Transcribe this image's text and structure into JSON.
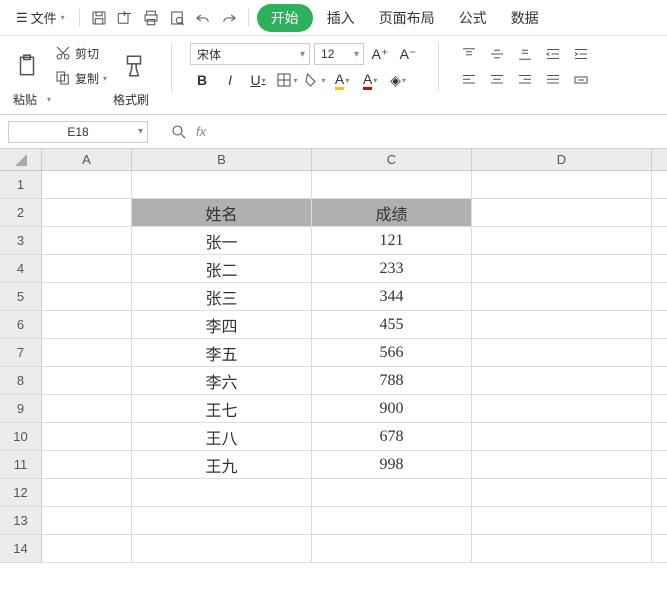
{
  "menu": {
    "file": "文件"
  },
  "tabs": {
    "start": "开始",
    "insert": "插入",
    "layout": "页面布局",
    "formula": "公式",
    "data": "数据"
  },
  "clip": {
    "paste": "粘贴",
    "cut": "剪切",
    "copy": "复制",
    "brush": "格式刷"
  },
  "font": {
    "name": "宋体",
    "size": "12"
  },
  "namebox": "E18",
  "cols": [
    "A",
    "B",
    "C",
    "D"
  ],
  "rows": [
    "1",
    "2",
    "3",
    "4",
    "5",
    "6",
    "7",
    "8",
    "9",
    "10",
    "11",
    "12",
    "13",
    "14"
  ],
  "chart_data": {
    "type": "table",
    "header": {
      "B": "姓名",
      "C": "成绩"
    },
    "rows": [
      {
        "B": "张一",
        "C": "121"
      },
      {
        "B": "张二",
        "C": "233"
      },
      {
        "B": "张三",
        "C": "344"
      },
      {
        "B": "李四",
        "C": "455"
      },
      {
        "B": "李五",
        "C": "566"
      },
      {
        "B": "李六",
        "C": "788"
      },
      {
        "B": "王七",
        "C": "900"
      },
      {
        "B": "王八",
        "C": "678"
      },
      {
        "B": "王九",
        "C": "998"
      }
    ]
  }
}
